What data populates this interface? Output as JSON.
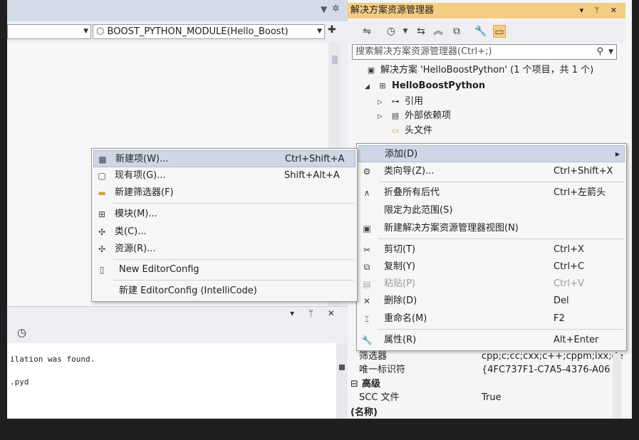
{
  "editor": {
    "member_combo": "BOOST_PYTHON_MODULE(Hello_Boost)",
    "pin_glyph": "▼",
    "gear_glyph": "✲",
    "add_glyph": "✚"
  },
  "output": {
    "line1": "ilation was found.",
    "line2": ".pyd",
    "clock_glyph": "◷",
    "panel_tools": "▾ ᛘ ✕"
  },
  "solution_explorer": {
    "title": "解决方案资源管理器",
    "title_buttons": "▾ ᛘ ✕",
    "search_placeholder": "搜索解决方案资源管理器(Ctrl+;)",
    "search_icon": "⚲",
    "tree": [
      {
        "label": "解决方案 'HelloBoostPython' (1 个项目，共 1 个)",
        "icon": "▣"
      },
      {
        "label": "HelloBoostPython",
        "icon": "⊞",
        "expand": "◢"
      },
      {
        "label": "引用",
        "icon": "⊶",
        "expand": "▷"
      },
      {
        "label": "外部依赖项",
        "icon": "▤",
        "expand": "▷"
      },
      {
        "label": "头文件",
        "icon": "▭"
      }
    ]
  },
  "properties": {
    "filter_label": "筛选器",
    "filter_value": "cpp;c;cc;cxx;c++;cppm;ixx;de",
    "guid_label": "唯一标识符",
    "guid_value": "{4FC737F1-C7A5-4376-A06",
    "section_advanced": "高级",
    "scc_label": "SCC 文件",
    "scc_value": "True",
    "name_section": "(名称)",
    "collapse_glyph": "⊟"
  },
  "main_menu": {
    "items": [
      {
        "label": "添加(D)",
        "shortcut": "",
        "icon": "",
        "submenu": true
      },
      {
        "label": "类向导(Z)...",
        "shortcut": "Ctrl+Shift+X",
        "icon": "⚙"
      },
      {
        "label": "折叠所有后代",
        "shortcut": "Ctrl+左箭头",
        "icon": "∧"
      },
      {
        "label": "限定为此范围(S)",
        "shortcut": "",
        "icon": ""
      },
      {
        "label": "新建解决方案资源管理器视图(N)",
        "shortcut": "",
        "icon": "▣"
      },
      {
        "label": "剪切(T)",
        "shortcut": "Ctrl+X",
        "icon": "✂"
      },
      {
        "label": "复制(Y)",
        "shortcut": "Ctrl+C",
        "icon": "⧉"
      },
      {
        "label": "粘贴(P)",
        "shortcut": "Ctrl+V",
        "icon": "▤"
      },
      {
        "label": "删除(D)",
        "shortcut": "Del",
        "icon": "✕"
      },
      {
        "label": "重命名(M)",
        "shortcut": "F2",
        "icon": "⌶"
      },
      {
        "label": "属性(R)",
        "shortcut": "Alt+Enter",
        "icon": "🔧"
      }
    ]
  },
  "add_submenu": {
    "items": [
      {
        "label": "新建项(W)...",
        "shortcut": "Ctrl+Shift+A",
        "icon": "▦"
      },
      {
        "label": "现有项(G)...",
        "shortcut": "Shift+Alt+A",
        "icon": "▢"
      },
      {
        "label": "新建筛选器(F)",
        "shortcut": "",
        "icon": "▬"
      },
      {
        "label": "模块(M)...",
        "shortcut": "",
        "icon": "⊞"
      },
      {
        "label": "类(C)...",
        "shortcut": "",
        "icon": "✣"
      },
      {
        "label": "资源(R)...",
        "shortcut": "",
        "icon": "✣"
      },
      {
        "label": "New EditorConfig",
        "shortcut": "",
        "icon": "▯"
      },
      {
        "label": "新建 EditorConfig (IntelliCode)",
        "shortcut": "",
        "icon": ""
      }
    ]
  },
  "colors": {
    "accent_title": "#f5cc84",
    "highlight": "#cfd6e5"
  }
}
